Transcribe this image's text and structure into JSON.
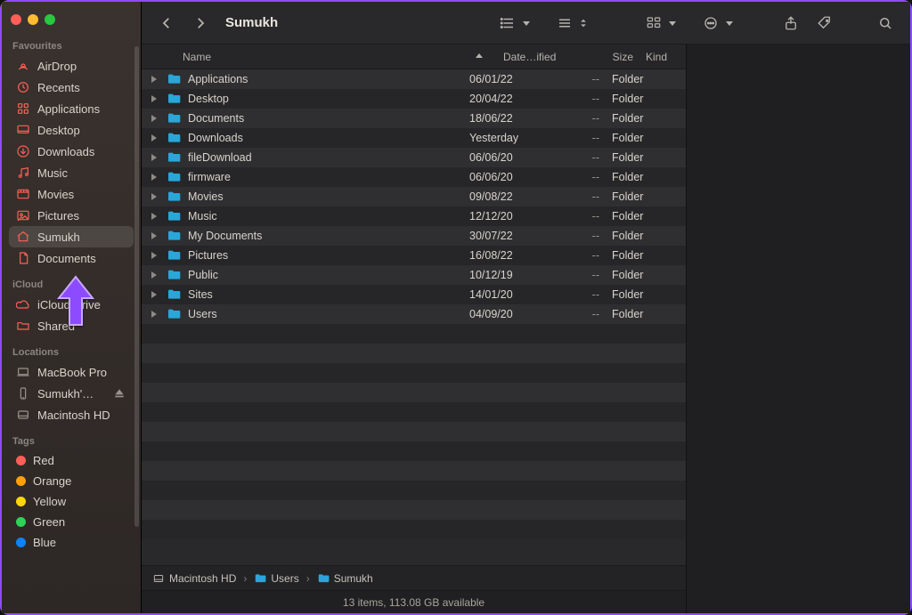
{
  "window": {
    "title": "Sumukh"
  },
  "toolbar": {
    "back": "Back",
    "forward": "Forward",
    "group": "Group",
    "view": "View Options",
    "display": "Display Options",
    "action": "Action",
    "share": "Share",
    "tags": "Edit Tags",
    "search": "Search"
  },
  "sidebar": {
    "sections": [
      {
        "title": "Favourites",
        "items": [
          {
            "label": "AirDrop",
            "icon": "airdrop",
            "accent": true
          },
          {
            "label": "Recents",
            "icon": "clock",
            "accent": true
          },
          {
            "label": "Applications",
            "icon": "apps",
            "accent": true
          },
          {
            "label": "Desktop",
            "icon": "desktop",
            "accent": true
          },
          {
            "label": "Downloads",
            "icon": "download",
            "accent": true
          },
          {
            "label": "Music",
            "icon": "music",
            "accent": true
          },
          {
            "label": "Movies",
            "icon": "movies",
            "accent": true
          },
          {
            "label": "Pictures",
            "icon": "pictures",
            "accent": true
          },
          {
            "label": "Sumukh",
            "icon": "home",
            "accent": true,
            "selected": true
          },
          {
            "label": "Documents",
            "icon": "doc",
            "accent": true
          }
        ]
      },
      {
        "title": "iCloud",
        "items": [
          {
            "label": "iCloud Drive",
            "icon": "cloud",
            "accent": true
          },
          {
            "label": "Shared",
            "icon": "sharedfolder",
            "accent": true
          }
        ]
      },
      {
        "title": "Locations",
        "items": [
          {
            "label": "MacBook Pro",
            "icon": "laptop"
          },
          {
            "label": "Sumukh'…",
            "icon": "phone",
            "eject": true
          },
          {
            "label": "Macintosh HD",
            "icon": "disk"
          }
        ]
      },
      {
        "title": "Tags",
        "items": [
          {
            "label": "Red",
            "tag": "red"
          },
          {
            "label": "Orange",
            "tag": "orange"
          },
          {
            "label": "Yellow",
            "tag": "yellow"
          },
          {
            "label": "Green",
            "tag": "green"
          },
          {
            "label": "Blue",
            "tag": "blue"
          }
        ]
      }
    ]
  },
  "columns": {
    "name": "Name",
    "date": "Date…ified",
    "size": "Size",
    "kind": "Kind"
  },
  "rows": [
    {
      "name": "Applications",
      "date": "06/01/22",
      "size": "--",
      "kind": "Folder"
    },
    {
      "name": "Desktop",
      "date": "20/04/22",
      "size": "--",
      "kind": "Folder"
    },
    {
      "name": "Documents",
      "date": "18/06/22",
      "size": "--",
      "kind": "Folder"
    },
    {
      "name": "Downloads",
      "date": "Yesterday",
      "size": "--",
      "kind": "Folder"
    },
    {
      "name": "fileDownload",
      "date": "06/06/20",
      "size": "--",
      "kind": "Folder"
    },
    {
      "name": "firmware",
      "date": "06/06/20",
      "size": "--",
      "kind": "Folder"
    },
    {
      "name": "Movies",
      "date": "09/08/22",
      "size": "--",
      "kind": "Folder"
    },
    {
      "name": "Music",
      "date": "12/12/20",
      "size": "--",
      "kind": "Folder"
    },
    {
      "name": "My Documents",
      "date": "30/07/22",
      "size": "--",
      "kind": "Folder"
    },
    {
      "name": "Pictures",
      "date": "16/08/22",
      "size": "--",
      "kind": "Folder"
    },
    {
      "name": "Public",
      "date": "10/12/19",
      "size": "--",
      "kind": "Folder"
    },
    {
      "name": "Sites",
      "date": "14/01/20",
      "size": "--",
      "kind": "Folder"
    },
    {
      "name": "Users",
      "date": "04/09/20",
      "size": "--",
      "kind": "Folder"
    }
  ],
  "pathbar": [
    {
      "label": "Macintosh HD",
      "icon": "disk"
    },
    {
      "label": "Users",
      "icon": "folder"
    },
    {
      "label": "Sumukh",
      "icon": "folder"
    }
  ],
  "status": "13 items, 113.08 GB available"
}
